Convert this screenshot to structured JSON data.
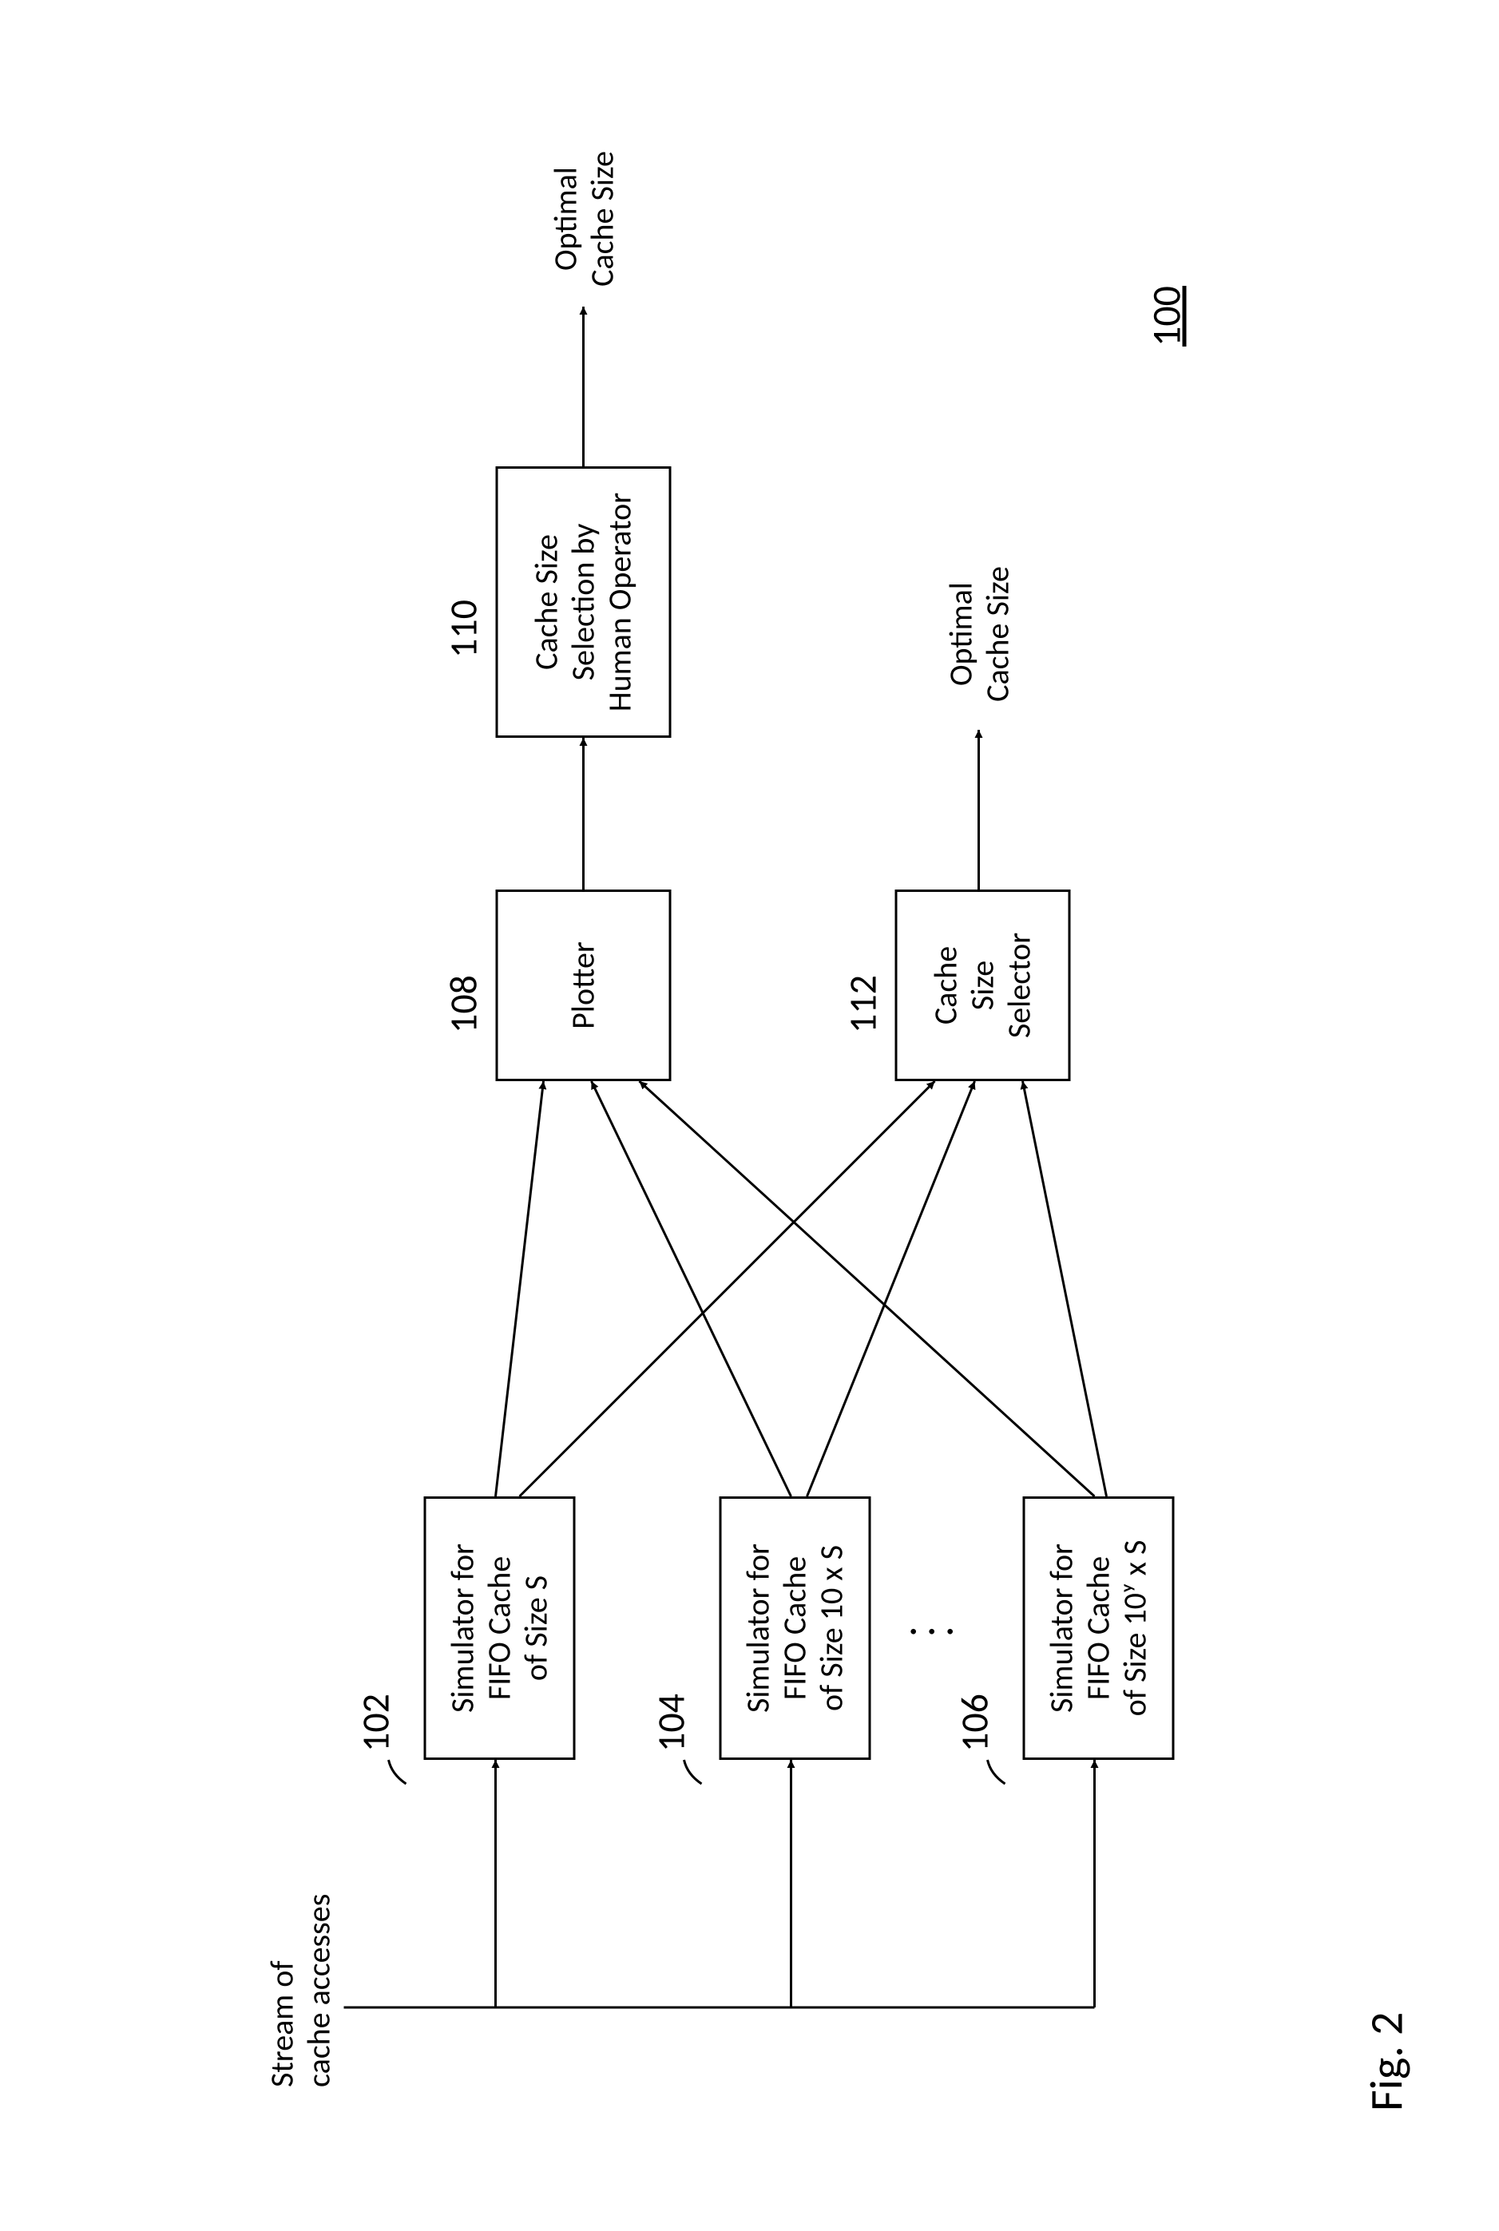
{
  "figure_label": "Fig. 2",
  "diagram_ref": "100",
  "input_label_line1": "Stream of",
  "input_label_line2": "cache accesses",
  "simulators": {
    "s1": {
      "ref": "102",
      "line1": "Simulator for",
      "line2": "FIFO Cache",
      "line3": "of Size S"
    },
    "s2": {
      "ref": "104",
      "line1": "Simulator for",
      "line2": "FIFO Cache",
      "line3": "of Size 10 x S"
    },
    "s3": {
      "ref": "106",
      "line1": "Simulator for",
      "line2": "FIFO Cache",
      "line3": "of Size 10ʸ x S"
    }
  },
  "plotter": {
    "ref": "108",
    "label": "Plotter"
  },
  "selector": {
    "ref": "112",
    "line1": "Cache",
    "line2": "Size",
    "line3": "Selector"
  },
  "human": {
    "ref": "110",
    "line1": "Cache Size",
    "line2": "Selection by",
    "line3": "Human Operator"
  },
  "output": {
    "line1": "Optimal",
    "line2": "Cache Size"
  }
}
